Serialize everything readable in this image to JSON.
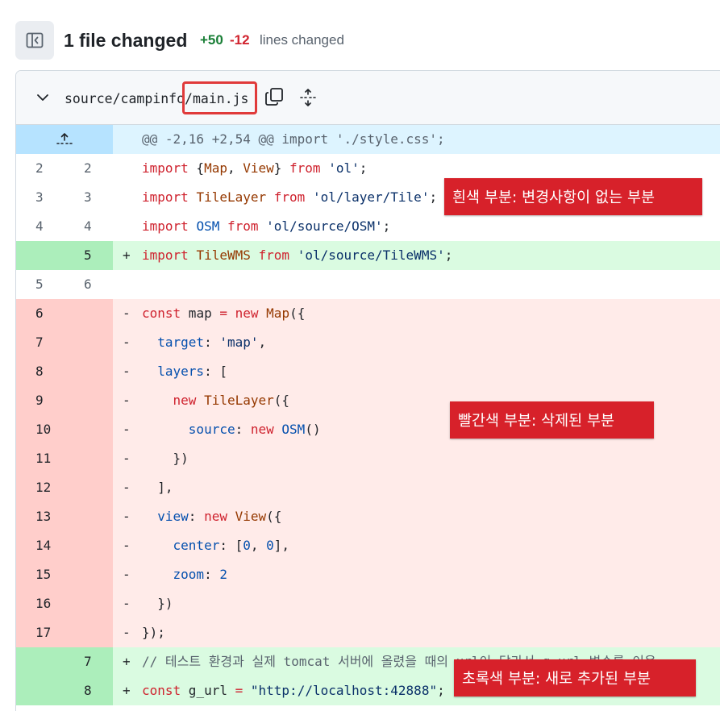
{
  "header": {
    "files_changed": "1 file changed",
    "additions": "+50",
    "deletions": "-12",
    "lines_changed": "lines changed"
  },
  "file": {
    "dir": "source/campinfo/",
    "name": "main.js"
  },
  "hunk": "@@ -2,16 +2,54 @@ import './style.css';",
  "annotations": {
    "white": "흰색 부분: 변경사항이 없는 부분",
    "red": "빨간색 부분: 삭제된 부분",
    "green": "초록색 부분: 새로 추가된 부분"
  },
  "lines": [
    {
      "type": "ctx",
      "old": "2",
      "new": "2",
      "sign": " "
    },
    {
      "type": "ctx",
      "old": "3",
      "new": "3",
      "sign": " "
    },
    {
      "type": "ctx",
      "old": "4",
      "new": "4",
      "sign": " "
    },
    {
      "type": "add",
      "old": "",
      "new": "5",
      "sign": "+"
    },
    {
      "type": "ctx",
      "old": "5",
      "new": "6",
      "sign": " "
    },
    {
      "type": "del",
      "old": "6",
      "new": "",
      "sign": "-"
    },
    {
      "type": "del",
      "old": "7",
      "new": "",
      "sign": "-"
    },
    {
      "type": "del",
      "old": "8",
      "new": "",
      "sign": "-"
    },
    {
      "type": "del",
      "old": "9",
      "new": "",
      "sign": "-"
    },
    {
      "type": "del",
      "old": "10",
      "new": "",
      "sign": "-"
    },
    {
      "type": "del",
      "old": "11",
      "new": "",
      "sign": "-"
    },
    {
      "type": "del",
      "old": "12",
      "new": "",
      "sign": "-"
    },
    {
      "type": "del",
      "old": "13",
      "new": "",
      "sign": "-"
    },
    {
      "type": "del",
      "old": "14",
      "new": "",
      "sign": "-"
    },
    {
      "type": "del",
      "old": "15",
      "new": "",
      "sign": "-"
    },
    {
      "type": "del",
      "old": "16",
      "new": "",
      "sign": "-"
    },
    {
      "type": "del",
      "old": "17",
      "new": "",
      "sign": "-"
    },
    {
      "type": "add",
      "old": "",
      "new": "7",
      "sign": "+"
    },
    {
      "type": "add",
      "old": "",
      "new": "8",
      "sign": "+"
    }
  ],
  "code": {
    "l0": [
      [
        "kw",
        "import"
      ],
      [
        "pl",
        " {"
      ],
      [
        "fn",
        "Map"
      ],
      [
        "pl",
        ", "
      ],
      [
        "fn",
        "View"
      ],
      [
        "pl",
        "} "
      ],
      [
        "kw",
        "from"
      ],
      [
        "pl",
        " "
      ],
      [
        "str",
        "'ol'"
      ],
      [
        "pl",
        ";"
      ]
    ],
    "l1": [
      [
        "kw",
        "import"
      ],
      [
        "pl",
        " "
      ],
      [
        "fn",
        "TileLayer"
      ],
      [
        "pl",
        " "
      ],
      [
        "kw",
        "from"
      ],
      [
        "pl",
        " "
      ],
      [
        "str",
        "'ol/layer/Tile'"
      ],
      [
        "pl",
        ";"
      ]
    ],
    "l2": [
      [
        "kw",
        "import"
      ],
      [
        "pl",
        " "
      ],
      [
        "prop",
        "OSM"
      ],
      [
        "pl",
        " "
      ],
      [
        "kw",
        "from"
      ],
      [
        "pl",
        " "
      ],
      [
        "str",
        "'ol/source/OSM'"
      ],
      [
        "pl",
        ";"
      ]
    ],
    "l3": [
      [
        "kw",
        "import"
      ],
      [
        "pl",
        " "
      ],
      [
        "fn",
        "TileWMS"
      ],
      [
        "pl",
        " "
      ],
      [
        "kw",
        "from"
      ],
      [
        "pl",
        " "
      ],
      [
        "str",
        "'ol/source/TileWMS'"
      ],
      [
        "pl",
        ";"
      ]
    ],
    "l4": [],
    "l5": [
      [
        "kw",
        "const"
      ],
      [
        "pl",
        " map "
      ],
      [
        "kw",
        "="
      ],
      [
        "pl",
        " "
      ],
      [
        "kw",
        "new"
      ],
      [
        "pl",
        " "
      ],
      [
        "fn",
        "Map"
      ],
      [
        "pl",
        "({"
      ]
    ],
    "l6": [
      [
        "pl",
        "  "
      ],
      [
        "prop",
        "target"
      ],
      [
        "pl",
        ": "
      ],
      [
        "str",
        "'map'"
      ],
      [
        "pl",
        ","
      ]
    ],
    "l7": [
      [
        "pl",
        "  "
      ],
      [
        "prop",
        "layers"
      ],
      [
        "pl",
        ": ["
      ]
    ],
    "l8": [
      [
        "pl",
        "    "
      ],
      [
        "kw",
        "new"
      ],
      [
        "pl",
        " "
      ],
      [
        "fn",
        "TileLayer"
      ],
      [
        "pl",
        "({"
      ]
    ],
    "l9": [
      [
        "pl",
        "      "
      ],
      [
        "prop",
        "source"
      ],
      [
        "pl",
        ": "
      ],
      [
        "kw",
        "new"
      ],
      [
        "pl",
        " "
      ],
      [
        "prop",
        "OSM"
      ],
      [
        "pl",
        "()"
      ]
    ],
    "l10": [
      [
        "pl",
        "    })"
      ]
    ],
    "l11": [
      [
        "pl",
        "  ],"
      ]
    ],
    "l12": [
      [
        "pl",
        "  "
      ],
      [
        "prop",
        "view"
      ],
      [
        "pl",
        ": "
      ],
      [
        "kw",
        "new"
      ],
      [
        "pl",
        " "
      ],
      [
        "fn",
        "View"
      ],
      [
        "pl",
        "({"
      ]
    ],
    "l13": [
      [
        "pl",
        "    "
      ],
      [
        "prop",
        "center"
      ],
      [
        "pl",
        ": ["
      ],
      [
        "num",
        "0"
      ],
      [
        "pl",
        ", "
      ],
      [
        "num",
        "0"
      ],
      [
        "pl",
        "],"
      ]
    ],
    "l14": [
      [
        "pl",
        "    "
      ],
      [
        "prop",
        "zoom"
      ],
      [
        "pl",
        ": "
      ],
      [
        "num",
        "2"
      ]
    ],
    "l15": [
      [
        "pl",
        "  })"
      ]
    ],
    "l16": [
      [
        "pl",
        "});"
      ]
    ],
    "l17": [
      [
        "cm",
        "// 테스트 환경과 실제 tomcat 서버에 올렸을 때의 url이 달라서 g_url 변수를 이용"
      ]
    ],
    "l18": [
      [
        "kw",
        "const"
      ],
      [
        "pl",
        " g_url "
      ],
      [
        "kw",
        "="
      ],
      [
        "pl",
        " "
      ],
      [
        "str",
        "\"http://localhost:42888\""
      ],
      [
        "pl",
        ";"
      ]
    ]
  }
}
